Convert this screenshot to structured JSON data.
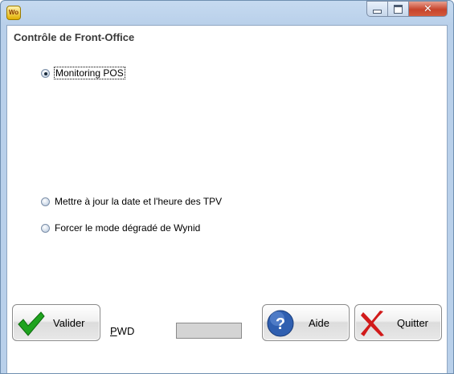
{
  "window": {
    "icon_text": "Wo",
    "icon_name": "wynid-app-icon"
  },
  "client": {
    "title": "Contrôle de Front-Office"
  },
  "options": [
    {
      "label": "Monitoring POS",
      "checked": true
    },
    {
      "label": "Mettre à jour la date et l'heure des TPV",
      "checked": false
    },
    {
      "label": "Forcer le mode dégradé de Wynid",
      "checked": false
    }
  ],
  "buttons": {
    "validate_label": "Valider",
    "help_label": "Aide",
    "quit_label": "Quitter"
  },
  "pwd": {
    "label_first": "P",
    "label_rest": "WD",
    "value": ""
  },
  "colors": {
    "validate_check": "#1fa31f",
    "help_circle": "#2f5fb0",
    "quit_x": "#d11a1a"
  }
}
